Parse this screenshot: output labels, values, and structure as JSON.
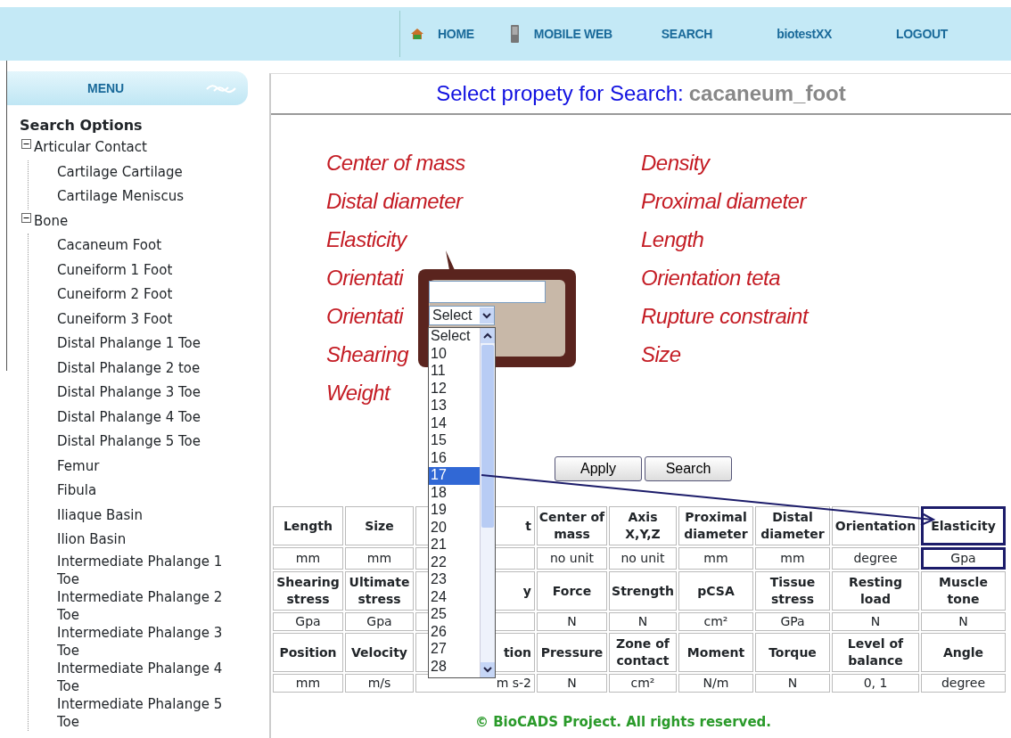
{
  "nav": [
    {
      "label": "HOME"
    },
    {
      "label": "MOBILE WEB"
    },
    {
      "label": "SEARCH"
    },
    {
      "label": "biotestXX"
    },
    {
      "label": "LOGOUT"
    }
  ],
  "menu": {
    "label": "MENU"
  },
  "sidebar": {
    "title": "Search Options",
    "tree": [
      {
        "label": "Articular Contact",
        "expanded": true,
        "children": [
          {
            "label": "Cartilage Cartilage"
          },
          {
            "label": "Cartilage Meniscus"
          }
        ]
      },
      {
        "label": "Bone",
        "expanded": true,
        "children": [
          {
            "label": "Cacaneum Foot"
          },
          {
            "label": "Cuneiform 1 Foot"
          },
          {
            "label": "Cuneiform 2 Foot"
          },
          {
            "label": "Cuneiform 3 Foot"
          },
          {
            "label": "Distal Phalange 1 Toe"
          },
          {
            "label": "Distal Phalange 2 toe"
          },
          {
            "label": "Distal Phalange 3 Toe"
          },
          {
            "label": "Distal Phalange 4 Toe"
          },
          {
            "label": "Distal Phalange 5 Toe"
          },
          {
            "label": "Femur"
          },
          {
            "label": "Fibula"
          },
          {
            "label": "Iliaque Basin"
          },
          {
            "label": "Ilion Basin"
          },
          {
            "label": "Intermediate Phalange 1 Toe"
          },
          {
            "label": "Intermediate Phalange 2 Toe"
          },
          {
            "label": "Intermediate Phalange 3 Toe"
          },
          {
            "label": "Intermediate Phalange 4 Toe"
          },
          {
            "label": "Intermediate Phalange 5 Toe"
          }
        ]
      }
    ]
  },
  "title": {
    "prefix": "Select propety for Search:",
    "subject": "cacaneum_foot"
  },
  "properties": [
    [
      "Center of mass",
      "Distal diameter",
      "Elasticity",
      "Orientati",
      "Orientati",
      "Shearing",
      "Weight"
    ],
    [
      "Density",
      "Proximal diameter",
      "Length",
      "Orientation teta",
      "Rupture constraint",
      "Size"
    ]
  ],
  "popup": {
    "select": "Select",
    "options": [
      {
        "label": "Select",
        "selected": false
      },
      {
        "label": "10",
        "selected": false
      },
      {
        "label": "11",
        "selected": false
      },
      {
        "label": "12",
        "selected": false
      },
      {
        "label": "13",
        "selected": false
      },
      {
        "label": "14",
        "selected": false
      },
      {
        "label": "15",
        "selected": false
      },
      {
        "label": "16",
        "selected": false
      },
      {
        "label": "17",
        "selected": true
      },
      {
        "label": "18",
        "selected": false
      },
      {
        "label": "19",
        "selected": false
      },
      {
        "label": "20",
        "selected": false
      },
      {
        "label": "21",
        "selected": false
      },
      {
        "label": "22",
        "selected": false
      },
      {
        "label": "23",
        "selected": false
      },
      {
        "label": "24",
        "selected": false
      },
      {
        "label": "25",
        "selected": false
      },
      {
        "label": "26",
        "selected": false
      },
      {
        "label": "27",
        "selected": false
      },
      {
        "label": "28",
        "selected": false
      }
    ]
  },
  "buttons": [
    "Apply",
    "Search"
  ],
  "table": {
    "rows": [
      {
        "kind": "header",
        "cells": [
          {
            "text": "Length",
            "highlighted": false
          },
          {
            "text": "Size",
            "highlighted": false
          },
          {
            "text": "t",
            "highlighted": false
          },
          {
            "text": "Center of mass",
            "highlighted": false
          },
          {
            "text": "Axis X,Y,Z",
            "highlighted": false
          },
          {
            "text": "Proximal diameter",
            "highlighted": false
          },
          {
            "text": "Distal diameter",
            "highlighted": false
          },
          {
            "text": "Orientation",
            "highlighted": false
          },
          {
            "text": "Elasticity",
            "highlighted": true
          }
        ]
      },
      {
        "kind": "unit",
        "cells": [
          {
            "text": "mm",
            "highlighted": false
          },
          {
            "text": "mm",
            "highlighted": false
          },
          {
            "highlighted": false
          },
          {
            "text": "no unit",
            "highlighted": false
          },
          {
            "text": "no unit",
            "highlighted": false
          },
          {
            "text": "mm",
            "highlighted": false
          },
          {
            "text": "mm",
            "highlighted": false
          },
          {
            "text": "degree",
            "highlighted": false
          },
          {
            "text": "Gpa",
            "highlighted": true
          }
        ]
      },
      {
        "kind": "header",
        "cells": [
          {
            "text": "Shearing stress",
            "highlighted": false
          },
          {
            "text": "Ultimate stress",
            "highlighted": false
          },
          {
            "text": "y",
            "highlighted": false
          },
          {
            "text": "Force",
            "highlighted": false
          },
          {
            "text": "Strength",
            "highlighted": false
          },
          {
            "text": "pCSA",
            "highlighted": false
          },
          {
            "text": "Tissue stress",
            "highlighted": false
          },
          {
            "text": "Resting load",
            "highlighted": false
          },
          {
            "text": "Muscle tone",
            "highlighted": false
          }
        ]
      },
      {
        "kind": "unit",
        "cells": [
          {
            "text": "Gpa",
            "highlighted": false
          },
          {
            "text": "Gpa",
            "highlighted": false
          },
          {
            "highlighted": false
          },
          {
            "text": "N",
            "highlighted": false
          },
          {
            "text": "N",
            "highlighted": false
          },
          {
            "text": "cm²",
            "highlighted": false
          },
          {
            "text": "GPa",
            "highlighted": false
          },
          {
            "text": "N",
            "highlighted": false
          },
          {
            "text": "N",
            "highlighted": false
          }
        ]
      },
      {
        "kind": "header",
        "cells": [
          {
            "text": "Position",
            "highlighted": false
          },
          {
            "text": "Velocity",
            "highlighted": false
          },
          {
            "text": "tion",
            "highlighted": false
          },
          {
            "text": "Pressure",
            "highlighted": false
          },
          {
            "text": "Zone of contact",
            "highlighted": false
          },
          {
            "text": "Moment",
            "highlighted": false
          },
          {
            "text": "Torque",
            "highlighted": false
          },
          {
            "text": "Level of balance",
            "highlighted": false
          },
          {
            "text": "Angle",
            "highlighted": false
          }
        ]
      },
      {
        "kind": "unit",
        "cells": [
          {
            "text": "mm",
            "highlighted": false
          },
          {
            "text": "m/s",
            "highlighted": false
          },
          {
            "text": "m s-2",
            "highlighted": false
          },
          {
            "text": "N",
            "highlighted": false
          },
          {
            "text": "cm²",
            "highlighted": false
          },
          {
            "text": "N/m",
            "highlighted": false
          },
          {
            "text": "N",
            "highlighted": false
          },
          {
            "text": "0, 1",
            "highlighted": false
          },
          {
            "text": "degree",
            "highlighted": false
          }
        ]
      }
    ]
  },
  "footer": "© BioCADS Project. All rights reserved."
}
